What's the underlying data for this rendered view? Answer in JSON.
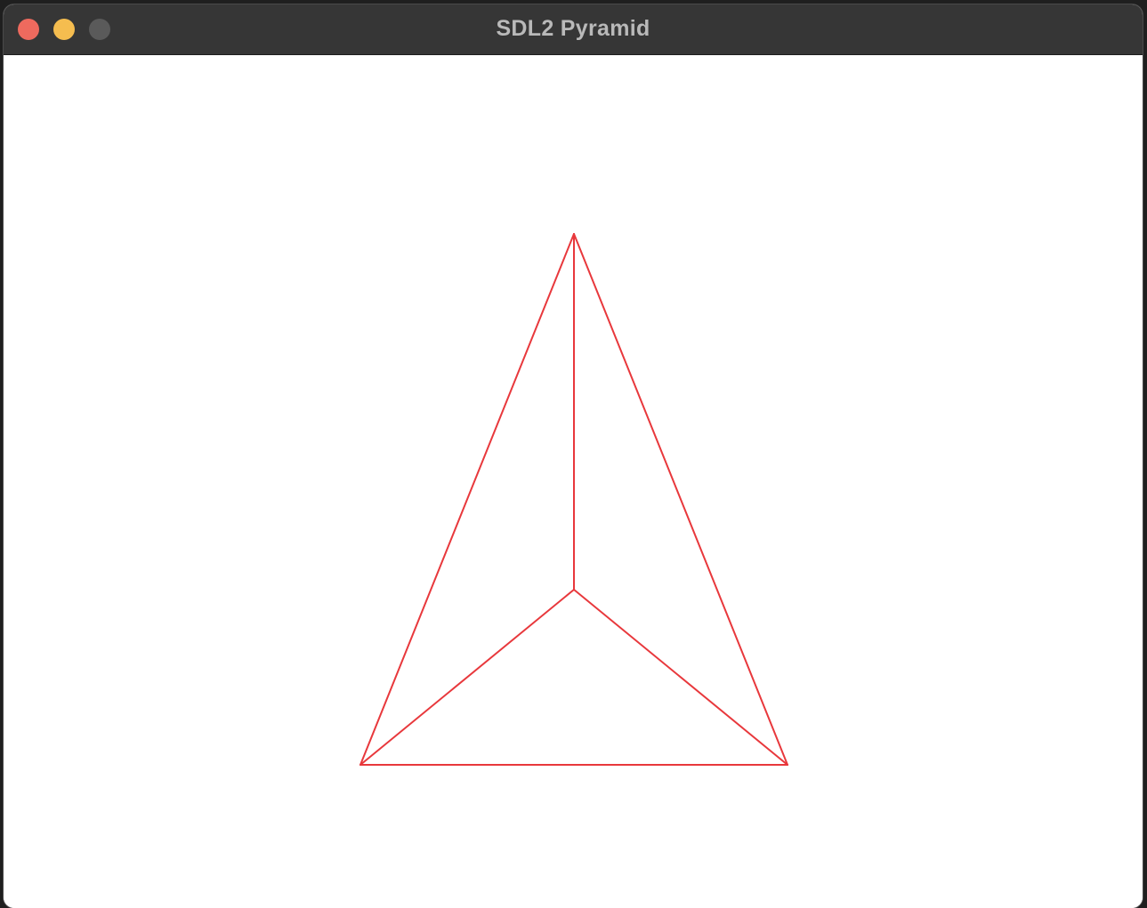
{
  "window": {
    "title": "SDL2 Pyramid"
  },
  "colors": {
    "titlebar": "#363636",
    "title_text": "#b9b9b9",
    "close": "#ee6a5e",
    "minimize": "#f5bd4f",
    "zoom": "#5a5a5a",
    "canvas_background": "#ffffff",
    "wireframe": "#e8383c"
  },
  "controls": {
    "close_icon": "close-icon",
    "minimize_icon": "minimize-icon",
    "zoom_icon": "zoom-icon"
  }
}
